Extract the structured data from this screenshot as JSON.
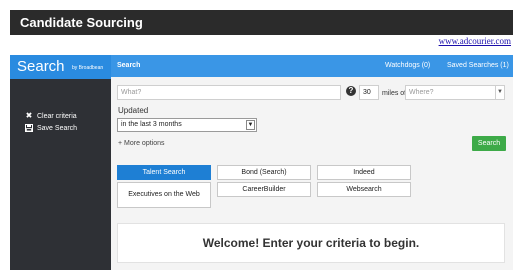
{
  "app": {
    "title": "Candidate Sourcing",
    "link": "www.adcourier.com"
  },
  "sidebar": {
    "brand": "Search",
    "brand_sub": "by Broadbean",
    "items": [
      {
        "label": "Clear criteria",
        "icon": "close-icon"
      },
      {
        "label": "Save Search",
        "icon": "save-icon"
      }
    ]
  },
  "topnav": {
    "search": "Search",
    "watchdogs": "Watchdogs (0)",
    "saved": "Saved Searches (1)"
  },
  "form": {
    "what_placeholder": "What?",
    "help": "?",
    "radius": "30",
    "miles_label": "miles of",
    "where_placeholder": "Where?",
    "updated_label": "Updated",
    "updated_value": "in the last 3 months",
    "more_options": "+ More options",
    "search_button": "Search"
  },
  "boards": [
    {
      "label": "Talent Search",
      "active": true
    },
    {
      "label": "Bond (Search)",
      "active": false
    },
    {
      "label": "Indeed",
      "active": false
    },
    {
      "label": "Executives on the Web",
      "active": false
    },
    {
      "label": "CareerBuilder",
      "active": false
    },
    {
      "label": "Websearch",
      "active": false
    }
  ],
  "welcome": "Welcome! Enter your criteria to begin.",
  "colors": {
    "accent": "#3a96e6",
    "active_board": "#1e7fd4",
    "search_button": "#3daa48",
    "sidebar": "#2e3035",
    "titlebar": "#2b2b2b"
  }
}
